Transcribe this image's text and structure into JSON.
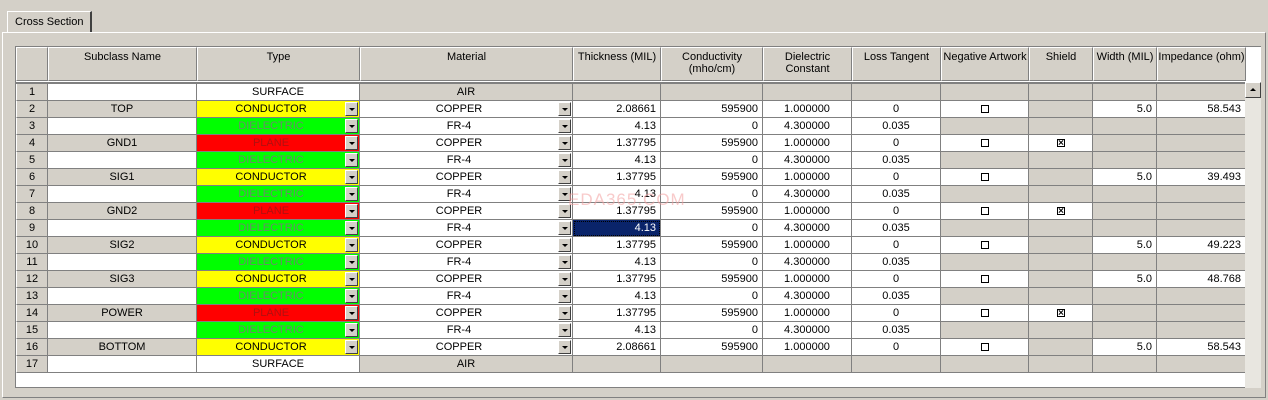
{
  "tab": {
    "label": "Cross Section"
  },
  "columns": [
    {
      "key": "subclass",
      "label": "Subclass Name"
    },
    {
      "key": "type",
      "label": "Type"
    },
    {
      "key": "material",
      "label": "Material"
    },
    {
      "key": "thickness",
      "label": "Thickness (MIL)"
    },
    {
      "key": "conductivity",
      "label": "Conductivity\n(mho/cm)"
    },
    {
      "key": "dielectric",
      "label": "Dielectric\nConstant"
    },
    {
      "key": "loss",
      "label": "Loss Tangent"
    },
    {
      "key": "negartwork",
      "label": "Negative Artwork"
    },
    {
      "key": "shield",
      "label": "Shield"
    },
    {
      "key": "width",
      "label": "Width (MIL)"
    },
    {
      "key": "impedance",
      "label": "Impedance (ohm)"
    }
  ],
  "colors": {
    "conductor": "#ffff00",
    "dielectric": "#00ff00",
    "plane": "#ff0000"
  },
  "rows": [
    {
      "num": "1",
      "name": "",
      "type": "SURFACE",
      "material": "AIR",
      "thickness": "",
      "conductivity": "",
      "dielectric": "",
      "loss": "",
      "negartwork": null,
      "shield": null,
      "width": "",
      "impedance": ""
    },
    {
      "num": "2",
      "name": "TOP",
      "type": "CONDUCTOR",
      "material": "COPPER",
      "thickness": "2.08661",
      "conductivity": "595900",
      "dielectric": "1.000000",
      "loss": "0",
      "negartwork": false,
      "shield": null,
      "width": "5.0",
      "impedance": "58.543"
    },
    {
      "num": "3",
      "name": "",
      "type": "DIELECTRIC",
      "material": "FR-4",
      "thickness": "4.13",
      "conductivity": "0",
      "dielectric": "4.300000",
      "loss": "0.035",
      "negartwork": null,
      "shield": null,
      "width": "",
      "impedance": ""
    },
    {
      "num": "4",
      "name": "GND1",
      "type": "PLANE",
      "material": "COPPER",
      "thickness": "1.37795",
      "conductivity": "595900",
      "dielectric": "1.000000",
      "loss": "0",
      "negartwork": false,
      "shield": true,
      "width": "",
      "impedance": ""
    },
    {
      "num": "5",
      "name": "",
      "type": "DIELECTRIC",
      "material": "FR-4",
      "thickness": "4.13",
      "conductivity": "0",
      "dielectric": "4.300000",
      "loss": "0.035",
      "negartwork": null,
      "shield": null,
      "width": "",
      "impedance": ""
    },
    {
      "num": "6",
      "name": "SIG1",
      "type": "CONDUCTOR",
      "material": "COPPER",
      "thickness": "1.37795",
      "conductivity": "595900",
      "dielectric": "1.000000",
      "loss": "0",
      "negartwork": false,
      "shield": null,
      "width": "5.0",
      "impedance": "39.493"
    },
    {
      "num": "7",
      "name": "",
      "type": "DIELECTRIC",
      "material": "FR-4",
      "thickness": "4.13",
      "conductivity": "0",
      "dielectric": "4.300000",
      "loss": "0.035",
      "negartwork": null,
      "shield": null,
      "width": "",
      "impedance": ""
    },
    {
      "num": "8",
      "name": "GND2",
      "type": "PLANE",
      "material": "COPPER",
      "thickness": "1.37795",
      "conductivity": "595900",
      "dielectric": "1.000000",
      "loss": "0",
      "negartwork": false,
      "shield": true,
      "width": "",
      "impedance": ""
    },
    {
      "num": "9",
      "name": "",
      "type": "DIELECTRIC",
      "material": "FR-4",
      "thickness": "4.13",
      "conductivity": "0",
      "dielectric": "4.300000",
      "loss": "0.035",
      "negartwork": null,
      "shield": null,
      "width": "",
      "impedance": "",
      "selected": true
    },
    {
      "num": "10",
      "name": "SIG2",
      "type": "CONDUCTOR",
      "material": "COPPER",
      "thickness": "1.37795",
      "conductivity": "595900",
      "dielectric": "1.000000",
      "loss": "0",
      "negartwork": false,
      "shield": null,
      "width": "5.0",
      "impedance": "49.223"
    },
    {
      "num": "11",
      "name": "",
      "type": "DIELECTRIC",
      "material": "FR-4",
      "thickness": "4.13",
      "conductivity": "0",
      "dielectric": "4.300000",
      "loss": "0.035",
      "negartwork": null,
      "shield": null,
      "width": "",
      "impedance": ""
    },
    {
      "num": "12",
      "name": "SIG3",
      "type": "CONDUCTOR",
      "material": "COPPER",
      "thickness": "1.37795",
      "conductivity": "595900",
      "dielectric": "1.000000",
      "loss": "0",
      "negartwork": false,
      "shield": null,
      "width": "5.0",
      "impedance": "48.768"
    },
    {
      "num": "13",
      "name": "",
      "type": "DIELECTRIC",
      "material": "FR-4",
      "thickness": "4.13",
      "conductivity": "0",
      "dielectric": "4.300000",
      "loss": "0.035",
      "negartwork": null,
      "shield": null,
      "width": "",
      "impedance": ""
    },
    {
      "num": "14",
      "name": "POWER",
      "type": "PLANE",
      "material": "COPPER",
      "thickness": "1.37795",
      "conductivity": "595900",
      "dielectric": "1.000000",
      "loss": "0",
      "negartwork": false,
      "shield": true,
      "width": "",
      "impedance": ""
    },
    {
      "num": "15",
      "name": "",
      "type": "DIELECTRIC",
      "material": "FR-4",
      "thickness": "4.13",
      "conductivity": "0",
      "dielectric": "4.300000",
      "loss": "0.035",
      "negartwork": null,
      "shield": null,
      "width": "",
      "impedance": ""
    },
    {
      "num": "16",
      "name": "BOTTOM",
      "type": "CONDUCTOR",
      "material": "COPPER",
      "thickness": "2.08661",
      "conductivity": "595900",
      "dielectric": "1.000000",
      "loss": "0",
      "negartwork": false,
      "shield": null,
      "width": "5.0",
      "impedance": "58.543"
    },
    {
      "num": "17",
      "name": "",
      "type": "SURFACE",
      "material": "AIR",
      "thickness": "",
      "conductivity": "",
      "dielectric": "",
      "loss": "",
      "negartwork": null,
      "shield": null,
      "width": "",
      "impedance": ""
    }
  ],
  "watermark": "EDA365.COM"
}
